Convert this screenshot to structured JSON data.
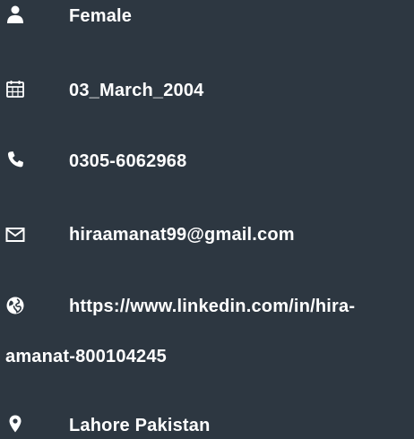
{
  "contact": {
    "items": [
      {
        "icon": "user-icon",
        "text": "Female"
      },
      {
        "icon": "calendar-icon",
        "text": "03_March_2004"
      },
      {
        "icon": "phone-icon",
        "text": "0305-6062968"
      },
      {
        "icon": "envelope-icon",
        "text": "hiraamanat99@gmail.com"
      },
      {
        "icon": "globe-icon",
        "text": "https://www.linkedin.com/in/hira-",
        "text_cont": "amanat-800104245"
      },
      {
        "icon": "map-marker-icon",
        "text": "Lahore Pakistan"
      }
    ]
  },
  "colors": {
    "background": "#2d3741",
    "text": "#ffffff"
  }
}
